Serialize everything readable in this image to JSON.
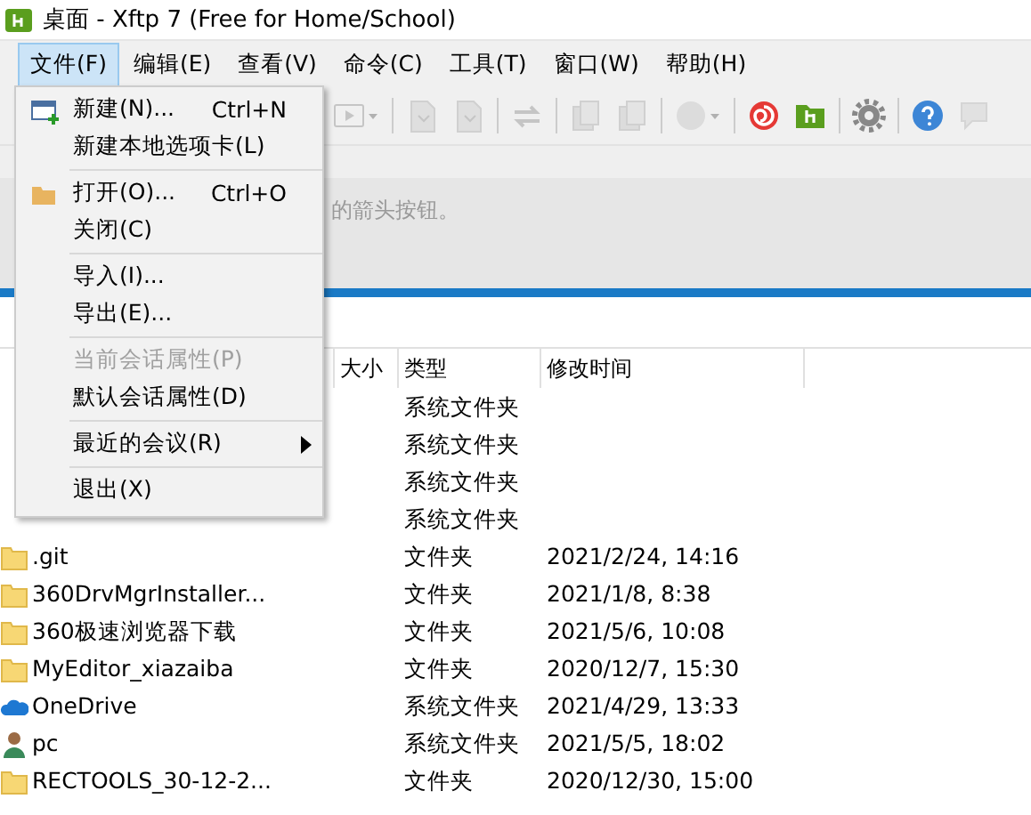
{
  "window": {
    "title": "桌面 - Xftp 7 (Free for Home/School)"
  },
  "menubar": [
    {
      "label": "文件(F)",
      "selected": true
    },
    {
      "label": "编辑(E)",
      "selected": false
    },
    {
      "label": "查看(V)",
      "selected": false
    },
    {
      "label": "命令(C)",
      "selected": false
    },
    {
      "label": "工具(T)",
      "selected": false
    },
    {
      "label": "窗口(W)",
      "selected": false
    },
    {
      "label": "帮助(H)",
      "selected": false
    }
  ],
  "toolbar": [
    {
      "kind": "play",
      "disabled": true
    },
    {
      "kind": "sep"
    },
    {
      "kind": "doc",
      "disabled": true
    },
    {
      "kind": "doc",
      "disabled": true
    },
    {
      "kind": "sep"
    },
    {
      "kind": "swap",
      "disabled": true
    },
    {
      "kind": "sep"
    },
    {
      "kind": "copy",
      "disabled": true
    },
    {
      "kind": "copy",
      "disabled": true
    },
    {
      "kind": "sep"
    },
    {
      "kind": "circle",
      "disabled": true
    },
    {
      "kind": "sep"
    },
    {
      "kind": "swirl",
      "disabled": false
    },
    {
      "kind": "logo",
      "disabled": false
    },
    {
      "kind": "sep"
    },
    {
      "kind": "gear",
      "disabled": false
    },
    {
      "kind": "sep"
    },
    {
      "kind": "help",
      "disabled": false
    },
    {
      "kind": "chat",
      "disabled": true
    }
  ],
  "message": "的箭头按钮。",
  "table": {
    "columns": [
      "大小",
      "类型",
      "修改时间"
    ],
    "rows": [
      {
        "kind": "covered",
        "type": "系统文件夹"
      },
      {
        "kind": "covered",
        "type": "系统文件夹"
      },
      {
        "kind": "covered",
        "type": "系统文件夹"
      },
      {
        "kind": "covered",
        "type": "系统文件夹"
      },
      {
        "kind": "folder",
        "name": ".git",
        "type": "文件夹",
        "modified": "2021/2/24, 14:16"
      },
      {
        "kind": "folder",
        "name": "360DrvMgrInstaller...",
        "type": "文件夹",
        "modified": "2021/1/8, 8:38"
      },
      {
        "kind": "folder",
        "name": "360极速浏览器下载",
        "type": "文件夹",
        "modified": "2021/5/6, 10:08"
      },
      {
        "kind": "folder",
        "name": "MyEditor_xiazaiba",
        "type": "文件夹",
        "modified": "2020/12/7, 15:30"
      },
      {
        "kind": "cloud",
        "name": "OneDrive",
        "type": "系统文件夹",
        "modified": "2021/4/29, 13:33"
      },
      {
        "kind": "user",
        "name": "pc",
        "type": "系统文件夹",
        "modified": "2021/5/5, 18:02"
      },
      {
        "kind": "folder",
        "name": "RECTOOLS_30-12-2...",
        "type": "文件夹",
        "modified": "2020/12/30, 15:00"
      }
    ]
  },
  "file_menu": [
    {
      "kind": "new",
      "label": "新建(N)...",
      "shortcut": "Ctrl+N",
      "disabled": false
    },
    {
      "kind": "item",
      "label": "新建本地选项卡(L)",
      "disabled": false
    },
    {
      "kind": "sep"
    },
    {
      "kind": "open",
      "label": "打开(O)...",
      "shortcut": "Ctrl+O",
      "disabled": false
    },
    {
      "kind": "item",
      "label": "关闭(C)",
      "disabled": false
    },
    {
      "kind": "sep"
    },
    {
      "kind": "item",
      "label": "导入(I)...",
      "disabled": false
    },
    {
      "kind": "item",
      "label": "导出(E)...",
      "disabled": false
    },
    {
      "kind": "sep"
    },
    {
      "kind": "item",
      "label": "当前会话属性(P)",
      "disabled": true
    },
    {
      "kind": "item",
      "label": "默认会话属性(D)",
      "disabled": false
    },
    {
      "kind": "sep"
    },
    {
      "kind": "submenu",
      "label": "最近的会议(R)",
      "disabled": false
    },
    {
      "kind": "sep"
    },
    {
      "kind": "item",
      "label": "退出(X)",
      "disabled": false
    }
  ]
}
